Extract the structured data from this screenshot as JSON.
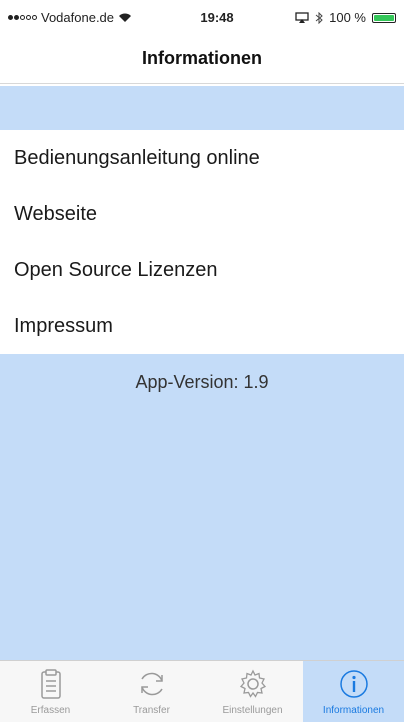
{
  "status_bar": {
    "carrier": "Vodafone.de",
    "time": "19:48",
    "battery_text": "100 %",
    "battery_percent": 100,
    "signal_dots_filled": 2
  },
  "nav": {
    "title": "Informationen"
  },
  "menu": {
    "items": [
      {
        "label": "Bedienungsanleitung online"
      },
      {
        "label": "Webseite"
      },
      {
        "label": "Open Source Lizenzen"
      },
      {
        "label": "Impressum"
      }
    ]
  },
  "info": {
    "version_text": "App-Version: 1.9"
  },
  "tabs": [
    {
      "label": "Erfassen",
      "icon": "clipboard-icon",
      "active": false
    },
    {
      "label": "Transfer",
      "icon": "refresh-icon",
      "active": false
    },
    {
      "label": "Einstellungen",
      "icon": "gear-icon",
      "active": false
    },
    {
      "label": "Informationen",
      "icon": "info-icon",
      "active": true
    }
  ],
  "colors": {
    "band": "#c4dcf8",
    "active_tab_label": "#1a7ae0",
    "inactive_tab": "#9a9a9a",
    "battery": "#34c759"
  }
}
